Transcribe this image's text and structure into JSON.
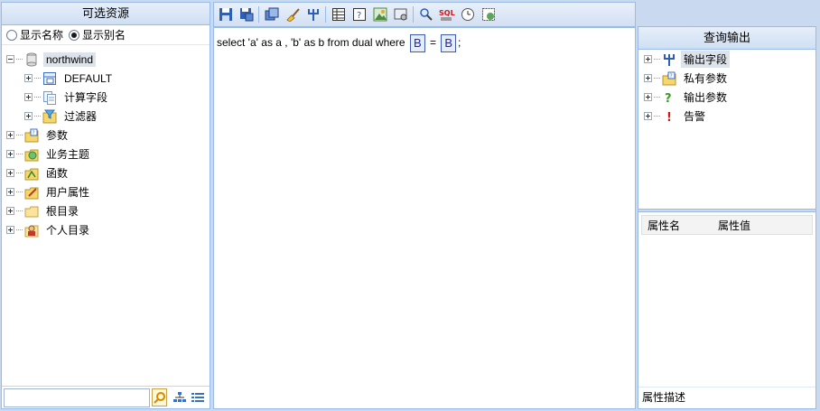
{
  "left_panel": {
    "title": "可选资源",
    "radio_name": "显示名称",
    "radio_alias": "显示别名",
    "radio_selected": "alias",
    "tree": [
      {
        "label": "northwind",
        "icon": "database-icon",
        "level": 0,
        "selected": true,
        "expanded": true
      },
      {
        "label": "DEFAULT",
        "icon": "table-icon",
        "level": 1
      },
      {
        "label": "计算字段",
        "icon": "calc-field-icon",
        "level": 1
      },
      {
        "label": "过滤器",
        "icon": "filter-icon",
        "level": 1
      },
      {
        "label": "参数",
        "icon": "parameter-folder-icon",
        "level": 0
      },
      {
        "label": "业务主题",
        "icon": "business-topic-icon",
        "level": 0
      },
      {
        "label": "函数",
        "icon": "function-folder-icon",
        "level": 0
      },
      {
        "label": "用户属性",
        "icon": "user-attribute-icon",
        "level": 0
      },
      {
        "label": "根目录",
        "icon": "folder-icon",
        "level": 0
      },
      {
        "label": "个人目录",
        "icon": "personal-folder-icon",
        "level": 0
      }
    ],
    "search_value": ""
  },
  "toolbar": {
    "buttons": [
      "save-icon",
      "save-as-icon",
      "separator",
      "copy-icon",
      "clear-icon",
      "field-icon",
      "separator",
      "table-view-icon",
      "help-query-icon",
      "image-icon",
      "settings-icon",
      "separator",
      "search-icon",
      "sql-icon",
      "clock-icon",
      "refresh-icon"
    ],
    "sql_label": "SQL"
  },
  "editor": {
    "sql_before": "select 'a' as a , 'b' as b from dual where",
    "param1": "B",
    "op": "=",
    "param2": "B",
    "sql_after": ";"
  },
  "right_panel": {
    "title": "查询输出",
    "tree": [
      {
        "label": "输出字段",
        "icon": "output-field-icon",
        "selected": true
      },
      {
        "label": "私有参数",
        "icon": "private-param-icon"
      },
      {
        "label": "输出参数",
        "icon": "output-param-icon"
      },
      {
        "label": "告警",
        "icon": "alert-icon"
      }
    ],
    "prop_name_header": "属性名",
    "prop_value_header": "属性值",
    "prop_desc": "属性描述"
  },
  "colors": {
    "border": "#99bbe8",
    "header_bg": "#cfdff3",
    "param_border": "#3a5ea8"
  }
}
